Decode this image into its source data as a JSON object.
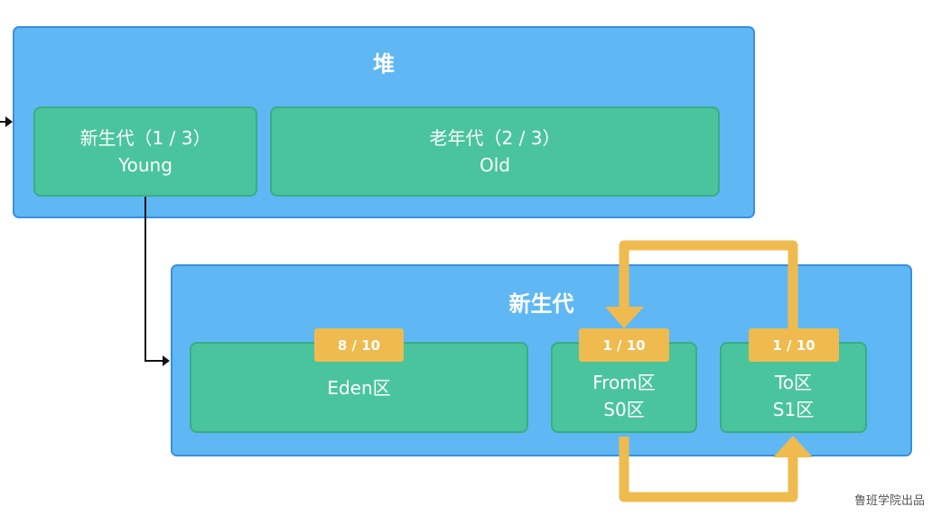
{
  "heap": {
    "title": "堆",
    "young": {
      "name": "新生代（1 / 3）",
      "english": "Young"
    },
    "old": {
      "name": "老年代（2 / 3）",
      "english": "Old"
    }
  },
  "young_gen": {
    "title": "新生代",
    "eden": {
      "label": "Eden区",
      "ratio": "8 / 10"
    },
    "from": {
      "label": "From区",
      "sub": "S0区",
      "ratio": "1 / 10"
    },
    "to": {
      "label": "To区",
      "sub": "S1区",
      "ratio": "1 / 10"
    }
  },
  "watermark": "鲁班学院出品",
  "colors": {
    "panel": "#5fb8f4",
    "box": "#4ac49c",
    "badge": "#efbb4f",
    "connector": "#111111"
  }
}
